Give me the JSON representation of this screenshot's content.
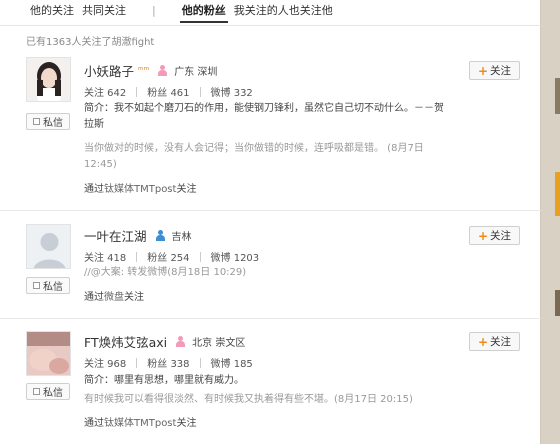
{
  "tabs": {
    "their_follows": "他的关注",
    "mutual": "共同关注",
    "separator": "|",
    "their_fans": "他的粉丝",
    "also_follow": "我关注的人也关注他"
  },
  "summary": "已有1363人关注了胡澈fight",
  "labels": {
    "message": "私信",
    "follow": "关注",
    "via_prefix": "通过"
  },
  "users": [
    {
      "name": "小妖路子",
      "verify_mark": "ᵐᵐ",
      "gender": "female",
      "location": "广东 深圳",
      "stats": [
        "关注 642",
        "粉丝 461",
        "微博 332"
      ],
      "bio": "简介：我不如起个磨刀石的作用，能使钢刀锋利，虽然它自己切不动什么。－－贺拉斯",
      "post": "当你做对的时候，没有人会记得；当你做错的时候，连呼吸都是错。 (8月7日 12:45)",
      "via_source": "钛媒体TMTpost",
      "via_suffix": "关注"
    },
    {
      "name": "一叶在江湖",
      "verify_mark": "",
      "gender": "male",
      "location": "吉林",
      "stats": [
        "关注 418",
        "粉丝 254",
        "微博 1203"
      ],
      "bio": "",
      "post": "//@大案: 转发微博(8月18日 10:29)",
      "via_source": "微盘",
      "via_suffix": "关注"
    },
    {
      "name": "FT焕炜艾弦axi",
      "verify_mark": "",
      "gender": "female",
      "location": "北京 崇文区",
      "stats": [
        "关注 968",
        "粉丝 338",
        "微博 185"
      ],
      "bio": "简介：哪里有思想，哪里就有威力。",
      "post": "有时候我可以看得很淡然、有时候我又执着得有些不堪。(8月17日 20:15)",
      "via_source": "钛媒体TMTpost",
      "via_suffix": "关注"
    }
  ],
  "colors": {
    "accent_plus": "#f08a1e",
    "female_icon": "#f39ab8",
    "male_icon": "#3c8fd6"
  }
}
